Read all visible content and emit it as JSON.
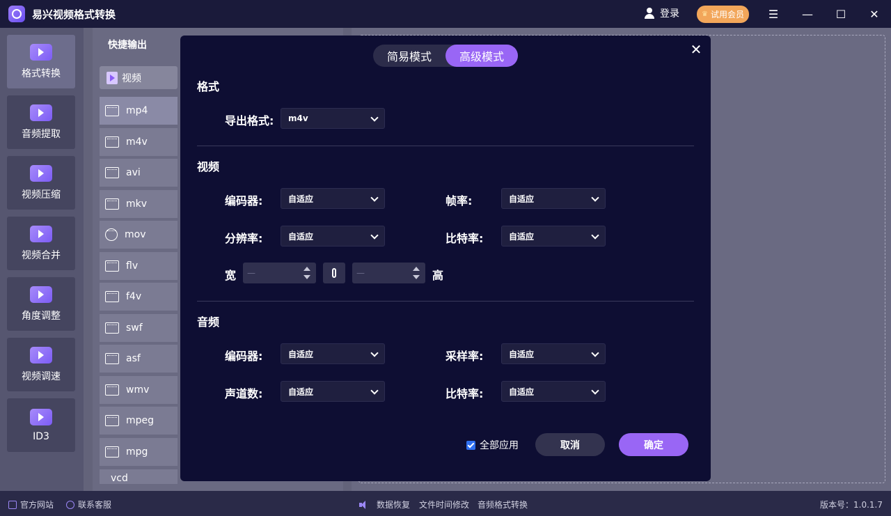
{
  "app": {
    "title": "易兴视频格式转换",
    "login": "登录",
    "vip": "试用会员"
  },
  "window": {
    "menu_icon": "☰",
    "minimize_icon": "—",
    "maximize_icon": "☐",
    "close_icon": "✕"
  },
  "nav": [
    {
      "label": "格式转换",
      "icon": "format-convert-icon"
    },
    {
      "label": "音频提取",
      "icon": "audio-extract-icon"
    },
    {
      "label": "视频压缩",
      "icon": "video-compress-icon"
    },
    {
      "label": "视频合并",
      "icon": "video-merge-icon"
    },
    {
      "label": "角度调整",
      "icon": "rotate-icon"
    },
    {
      "label": "视频调速",
      "icon": "speed-icon"
    },
    {
      "label": "ID3",
      "icon": "id3-edit-icon"
    }
  ],
  "formats": {
    "header": "快捷输出",
    "category": "视频",
    "items": [
      "mp4",
      "m4v",
      "avi",
      "mkv",
      "mov",
      "flv",
      "f4v",
      "swf",
      "asf",
      "wmv",
      "mpeg",
      "mpg",
      "vcd"
    ]
  },
  "dialog": {
    "modes": [
      "简易模式",
      "高级模式"
    ],
    "active_mode": "高级模式",
    "format_section": {
      "title": "格式",
      "export_label": "导出格式:",
      "export_value": "m4v"
    },
    "video_section": {
      "title": "视频",
      "encoder_label": "编码器:",
      "encoder_value": "自适应",
      "framerate_label": "帧率:",
      "framerate_value": "自适应",
      "resolution_label": "分辨率:",
      "resolution_value": "自适应",
      "bitrate_label": "比特率:",
      "bitrate_value": "自适应",
      "width_label": "宽",
      "width_value": "—",
      "height_label": "高",
      "height_value": "—"
    },
    "audio_section": {
      "title": "音频",
      "encoder_label": "编码器:",
      "encoder_value": "自适应",
      "samplerate_label": "采样率:",
      "samplerate_value": "自适应",
      "channels_label": "声道数:",
      "channels_value": "自适应",
      "bitrate_label": "比特率:",
      "bitrate_value": "自适应"
    },
    "apply_all": "全部应用",
    "apply_all_checked": true,
    "cancel": "取消",
    "confirm": "确定"
  },
  "statusbar": {
    "website": "官方网站",
    "support": "联系客服",
    "data_recovery": "数据恢复",
    "file_time": "文件时间修改",
    "audio_convert": "音频格式转换",
    "version": "版本号：1.0.1.7"
  },
  "colors": {
    "accent": "#9966f5",
    "modal_bg": "#0e0e33",
    "titlebar": "#1a1a3a",
    "vip": "#f2a65a"
  }
}
